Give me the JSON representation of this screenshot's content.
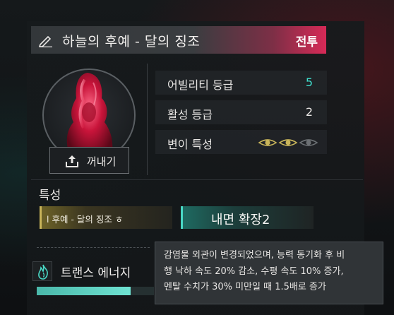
{
  "header": {
    "title": "하늘의 후예 - 달의 징조",
    "tag": "전투",
    "edit_icon": "pencil-icon"
  },
  "portrait": {
    "subject": "crimson translucent hooded figure"
  },
  "extract_button": {
    "label": "꺼내기",
    "icon": "upload-icon"
  },
  "stats": [
    {
      "name": "어빌리티 등급",
      "value": "5",
      "value_color": "#3fe0cf"
    },
    {
      "name": "활성 등급",
      "value": "2"
    },
    {
      "name": "변이 특성",
      "eyes": {
        "active": 2,
        "total": 3
      }
    }
  ],
  "traits": {
    "label": "특성",
    "chips": [
      {
        "text": "l 후예 - 달의 징조  ㅎ",
        "color": "#c9b55a"
      },
      {
        "text": "내면 확장2",
        "color": "#49d8c5"
      }
    ]
  },
  "energy": {
    "icon": "flame-icon",
    "label": "트랜스 에너지",
    "fill_fraction": 0.8
  },
  "tooltip": {
    "lines": [
      "감염물 외관이 변경되었으며, 능력 동기화 후 비",
      "행 낙하 속도 20% 감소, 수평 속도 10% 증가,",
      "멘탈 수치가 30% 미만일 때 1.5배로 증가"
    ]
  }
}
